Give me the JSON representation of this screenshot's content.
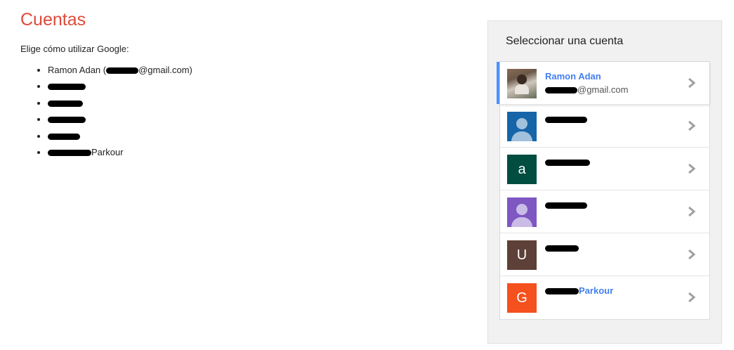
{
  "left": {
    "title": "Cuentas",
    "subtitle": "Elige cómo utilizar Google:",
    "items": [
      {
        "prefix": "Ramon Adan (",
        "suffix": "@gmail.com)"
      },
      {
        "prefix": "",
        "suffix": ""
      },
      {
        "prefix": "",
        "suffix": ""
      },
      {
        "prefix": "",
        "suffix": ""
      },
      {
        "prefix": "",
        "suffix": ""
      },
      {
        "prefix": "",
        "suffix": "Parkour"
      }
    ]
  },
  "panel": {
    "heading": "Seleccionar una cuenta",
    "accounts": [
      {
        "name": "Ramon Adan",
        "email_suffix": "@gmail.com",
        "avatar_letter": "",
        "avatar_color": "#7a6a5a",
        "avatar_type": "photo"
      },
      {
        "name": "",
        "email_suffix": "",
        "avatar_letter": "",
        "avatar_color": "#1565a8",
        "avatar_type": "person"
      },
      {
        "name": "",
        "email_suffix": "",
        "avatar_letter": "a",
        "avatar_color": "#014d40",
        "avatar_type": "letter"
      },
      {
        "name": "",
        "email_suffix": "",
        "avatar_letter": "",
        "avatar_color": "#7e57c2",
        "avatar_type": "person"
      },
      {
        "name": "",
        "email_suffix": "",
        "avatar_letter": "U",
        "avatar_color": "#5d4037",
        "avatar_type": "letter"
      },
      {
        "name": "Parkour",
        "email_suffix": "",
        "avatar_letter": "G",
        "avatar_color": "#f4511e",
        "avatar_type": "letter"
      }
    ]
  },
  "colors": {
    "title": "#dd4b39",
    "link": "#427fed",
    "active_bar": "#4d90fe",
    "panel_bg": "#f1f1f1"
  },
  "icons": {
    "chevron": "chevron-right-icon"
  }
}
